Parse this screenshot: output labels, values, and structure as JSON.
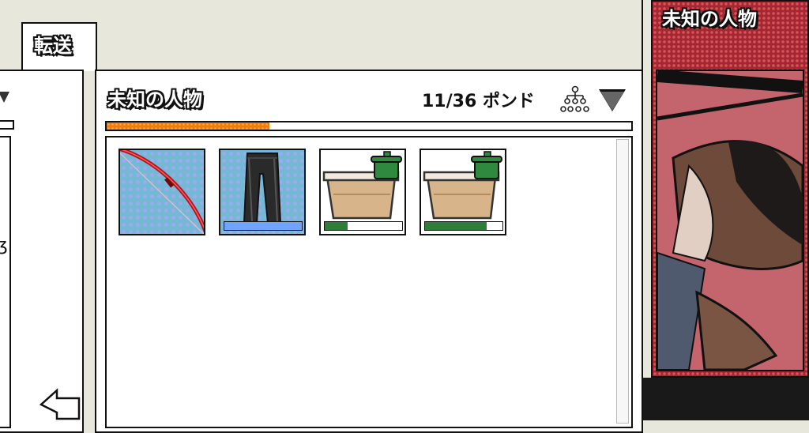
{
  "tab": {
    "label": "転送"
  },
  "container": {
    "title": "未知の人物",
    "weight_label": "11/36 ポンド",
    "capacity_fraction": 0.31
  },
  "items": [
    {
      "name": "bow",
      "icon": "bow-icon",
      "style": "blue",
      "durability": null
    },
    {
      "name": "pants",
      "icon": "pants-icon",
      "style": "blue",
      "durability": 1.0,
      "bar_color": "#6ea3ff"
    },
    {
      "name": "food-container",
      "icon": "food-container-icon",
      "style": "white",
      "durability": 0.3,
      "bar_color": "#2e7d38"
    },
    {
      "name": "food-container",
      "icon": "food-container-icon",
      "style": "white",
      "durability": 0.8,
      "bar_color": "#2e7d38"
    }
  ],
  "character": {
    "title": "未知の人物"
  },
  "colors": {
    "accent": "#f07d0a",
    "panel_red": "#a32831"
  }
}
